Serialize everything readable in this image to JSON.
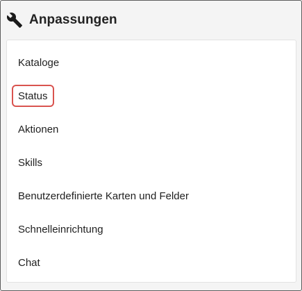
{
  "header": {
    "icon": "wrench-icon",
    "title": "Anpassungen"
  },
  "menu": {
    "items": [
      {
        "label": "Kataloge"
      },
      {
        "label": "Status"
      },
      {
        "label": "Aktionen"
      },
      {
        "label": "Skills"
      },
      {
        "label": "Benutzerdefinierte Karten und Felder"
      },
      {
        "label": "Schnelleinrichtung"
      },
      {
        "label": "Chat"
      }
    ]
  },
  "colors": {
    "highlight_border": "#d9534f",
    "background": "#f4f4f4",
    "panel": "#ffffff"
  }
}
